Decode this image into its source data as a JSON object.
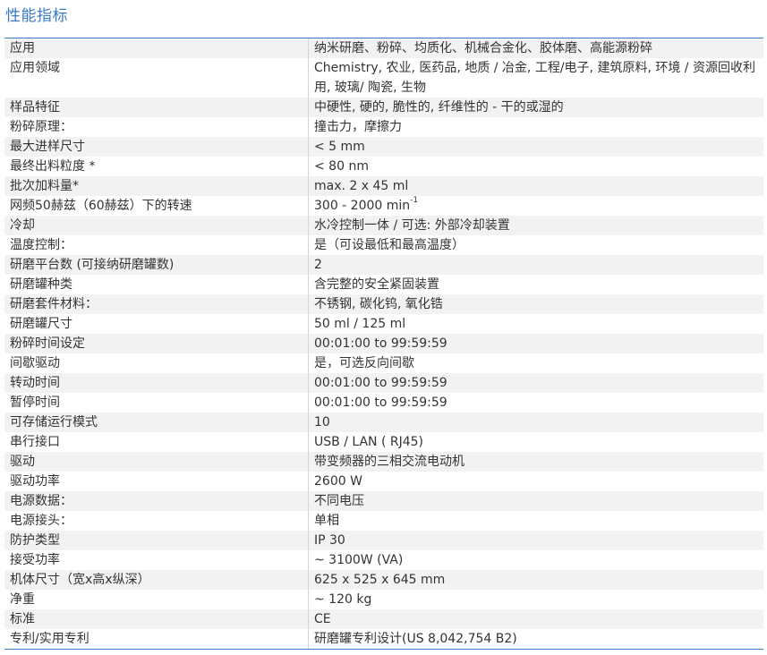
{
  "title": "性能指标",
  "rows": [
    {
      "k": "应用",
      "v": "纳米研磨、粉碎、均质化、机械合金化、胶体磨、高能源粉碎"
    },
    {
      "k": "应用领域",
      "v": "Chemistry, 农业, 医药品, 地质 / 冶金, 工程/电子, 建筑原料, 环境 / 资源回收利用, 玻璃/ 陶瓷, 生物"
    },
    {
      "k": "样品特征",
      "v": "中硬性, 硬的, 脆性的, 纤维性的 - 干的或湿的"
    },
    {
      "k": "粉碎原理：",
      "v": "撞击力，摩擦力"
    },
    {
      "k": "最大进样尺寸",
      "v": "< 5 mm"
    },
    {
      "k": "最终出料粒度 *",
      "v": "< 80 nm"
    },
    {
      "k": "批次加料量*",
      "v": "max. 2 x 45 ml"
    },
    {
      "k": "网频50赫兹（60赫兹）下的转速",
      "v": "300 - 2000 min",
      "sup": "-1"
    },
    {
      "k": "冷却",
      "v": "水冷控制一体 / 可选: 外部冷却装置"
    },
    {
      "k": "温度控制：",
      "v": "是（可设最低和最高温度）"
    },
    {
      "k": "研磨平台数 (可接纳研磨罐数)",
      "v": "2"
    },
    {
      "k": "研磨罐种类",
      "v": "含完整的安全紧固装置"
    },
    {
      "k": "研磨套件材料：",
      "v": "不锈钢, 碳化钨, 氧化锆"
    },
    {
      "k": "研磨罐尺寸",
      "v": "50 ml / 125 ml"
    },
    {
      "k": "粉碎时间设定",
      "v": "00:01:00 to 99:59:59"
    },
    {
      "k": "间歇驱动",
      "v": "是，可选反向间歇"
    },
    {
      "k": "转动时间",
      "v": "00:01:00 to 99:59:59"
    },
    {
      "k": "暂停时间",
      "v": "00:01:00 to 99:59:59"
    },
    {
      "k": "可存储运行模式",
      "v": "10"
    },
    {
      "k": "串行接口",
      "v": "USB / LAN ( RJ45)"
    },
    {
      "k": "驱动",
      "v": "带变频器的三相交流电动机"
    },
    {
      "k": "驱动功率",
      "v": "2600 W"
    },
    {
      "k": "电源数据：",
      "v": "不同电压"
    },
    {
      "k": "电源接头：",
      "v": "单相"
    },
    {
      "k": "防护类型",
      "v": "IP 30"
    },
    {
      "k": "接受功率",
      "v": "~ 3100W (VA)"
    },
    {
      "k": "机体尺寸（宽x高x纵深）",
      "v": "625 x 525 x 645 mm"
    },
    {
      "k": "净重",
      "v": "~ 120 kg"
    },
    {
      "k": "标准",
      "v": "CE"
    },
    {
      "k": "专利/实用专利",
      "v": "研磨罐专利设计(US 8,042,754 B2)"
    }
  ]
}
